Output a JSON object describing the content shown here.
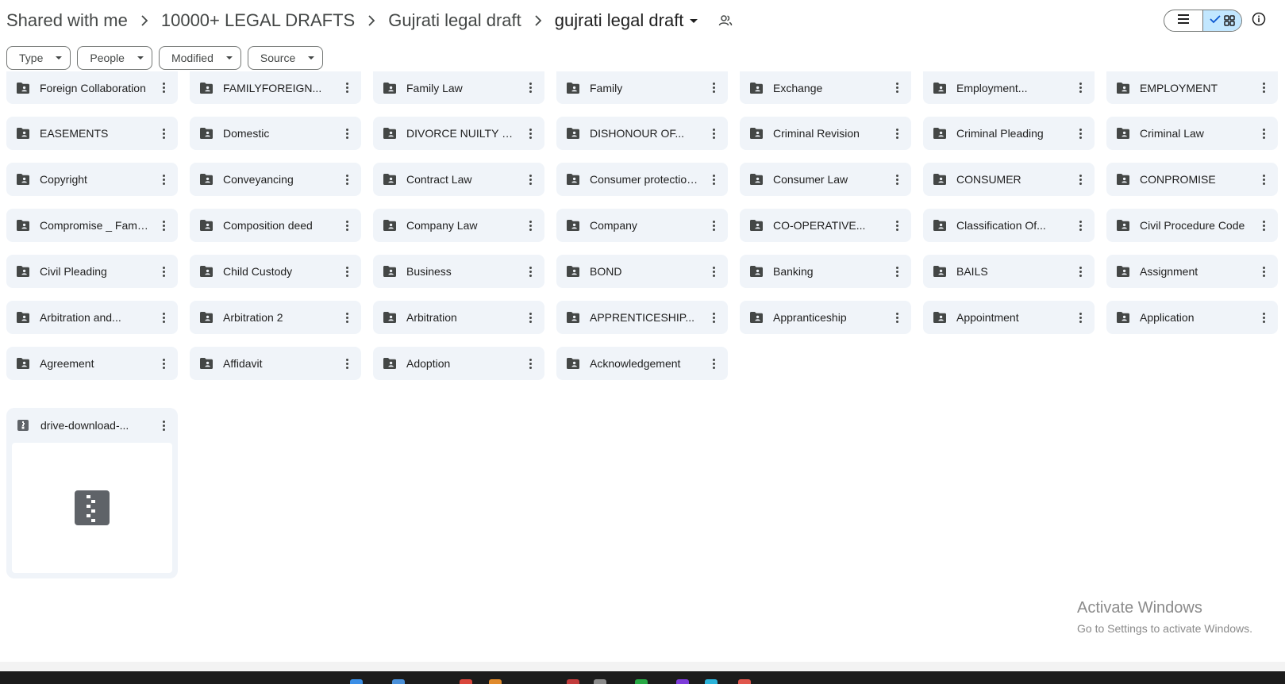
{
  "breadcrumb": {
    "items": [
      "Shared with me",
      "10000+ LEGAL DRAFTS",
      "Gujrati legal draft"
    ],
    "current": "gujrati legal draft"
  },
  "filters": [
    "Type",
    "People",
    "Modified",
    "Source"
  ],
  "folders": [
    "Foreign Collaboration",
    "FAMILYFOREIGN...",
    "Family Law",
    "Family",
    "Exchange",
    "Employment...",
    "EMPLOYMENT",
    "EASEMENTS",
    "Domestic",
    "DIVORCE NUILTY OF...",
    "DISHONOUR OF...",
    "Criminal Revision",
    "Criminal Pleading",
    "Criminal Law",
    "Copyright",
    "Conveyancing",
    "Contract Law",
    "Consumer protection...",
    "Consumer Law",
    "CONSUMER",
    "CONPROMISE",
    "Compromise _ Family...",
    "Composition deed",
    "Company Law",
    "Company",
    "CO-OPERATIVE...",
    "Classification Of...",
    "Civil Procedure Code",
    "Civil Pleading",
    "Child Custody",
    "Business",
    "BOND",
    "Banking",
    "BAILS",
    "Assignment",
    "Arbitration and...",
    "Arbitration 2",
    "Arbitration",
    "APPRENTICESHIP...",
    "Appranticeship",
    "Appointment",
    "Application",
    "Agreement",
    "Affidavit",
    "Adoption",
    "Acknowledgement"
  ],
  "files": [
    {
      "name": "drive-download-...",
      "icon": "zip-file-icon"
    }
  ],
  "watermark": {
    "title": "Activate Windows",
    "subtitle": "Go to Settings to activate Windows."
  },
  "colors": {
    "card_bg": "#f0f4f9",
    "toggle_active": "#c2e7ff",
    "icon_gray": "#444746"
  }
}
